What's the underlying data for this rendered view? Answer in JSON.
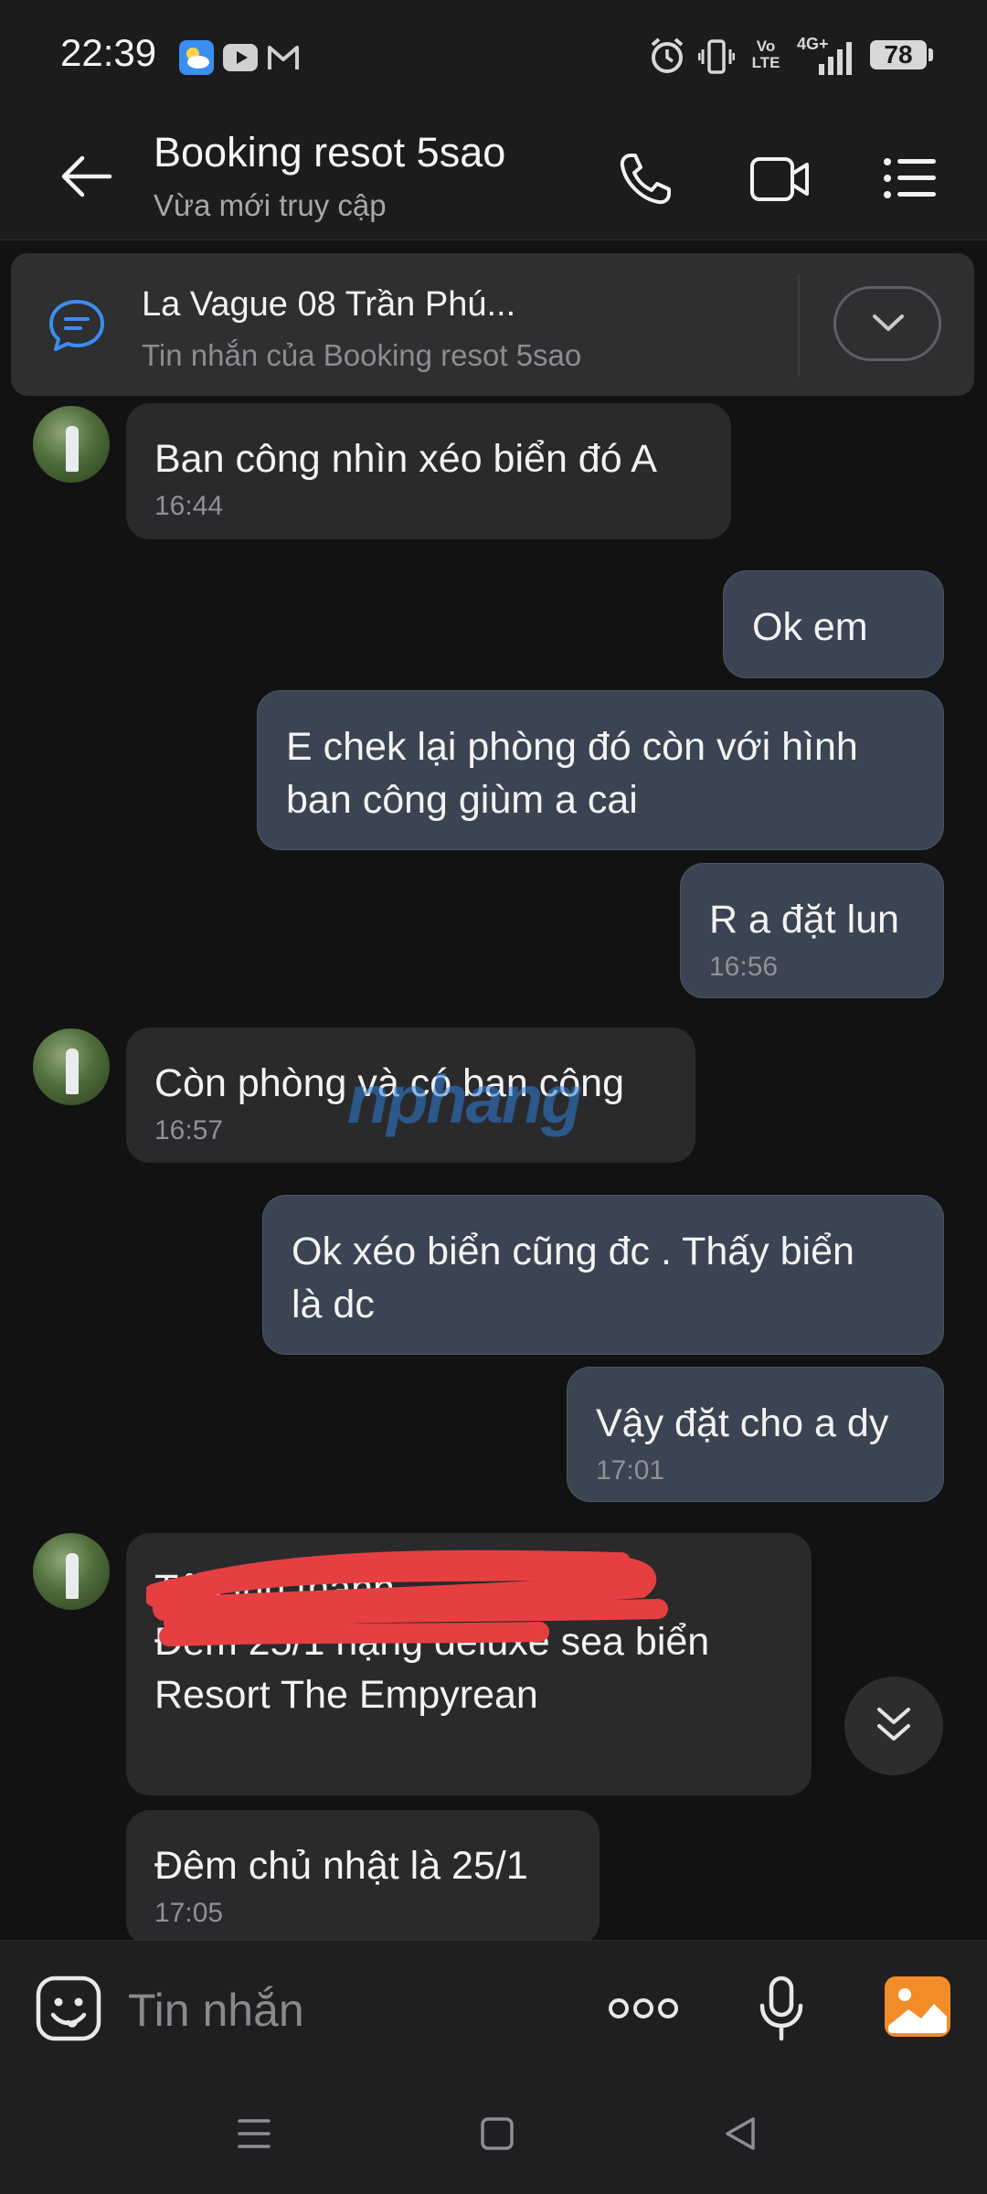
{
  "status_bar": {
    "time": "22:39",
    "battery": "78",
    "network": "4G+",
    "icons": [
      "weather-icon",
      "youtube-icon",
      "gmail-icon",
      "alarm-icon",
      "vibrate-icon",
      "volte-icon",
      "signal-icon",
      "battery-icon"
    ]
  },
  "header": {
    "title": "Booking resot 5sao",
    "subtitle": "Vừa mới truy cập",
    "icons": [
      "back-arrow-icon",
      "phone-icon",
      "video-call-icon",
      "menu-list-icon"
    ]
  },
  "pinned": {
    "title": "La Vague 08 Trần Phú...",
    "subtitle": "Tin nhắn của Booking resot 5sao",
    "icons": [
      "message-bubble-icon",
      "chevron-down-icon"
    ]
  },
  "messages": [
    {
      "dir": "in",
      "text": "Ban công nhìn xéo biển đó A",
      "time": "16:44"
    },
    {
      "dir": "out",
      "text": "Ok em",
      "time": ""
    },
    {
      "dir": "out",
      "text": "E chek lại phòng đó còn với hình\nban công giùm a cai",
      "time": ""
    },
    {
      "dir": "out",
      "text": "R a đặt lun",
      "time": "16:56"
    },
    {
      "dir": "in",
      "text": "Còn phòng và có ban công",
      "time": "16:57"
    },
    {
      "dir": "out",
      "text": "Ok xéo biển cũng đc . Thấy biển\nlà dc",
      "time": ""
    },
    {
      "dir": "out",
      "text": "Vậy đặt cho a dy",
      "time": "17:01"
    },
    {
      "dir": "in",
      "text": "Tên                              inh thành\nĐêm 25/1 hạng deluxe sea biển\nResort The Empyrean",
      "time": ""
    },
    {
      "dir": "in",
      "text": "Đêm chủ nhật là 25/1",
      "time": "17:05"
    }
  ],
  "watermark": "nphang",
  "input": {
    "placeholder": "Tin nhắn",
    "icons": [
      "sticker-emoji-icon",
      "more-options-icon",
      "microphone-icon",
      "image-gallery-icon"
    ]
  },
  "nav_bar": {
    "icons": [
      "recent-apps-icon",
      "home-icon",
      "back-icon"
    ]
  },
  "colors": {
    "background": "#121212",
    "incoming_bubble": "#2a2a2c",
    "outgoing_bubble": "#3a4452",
    "accent_blue": "#3a8ef0",
    "image_button": "#f28c28"
  }
}
